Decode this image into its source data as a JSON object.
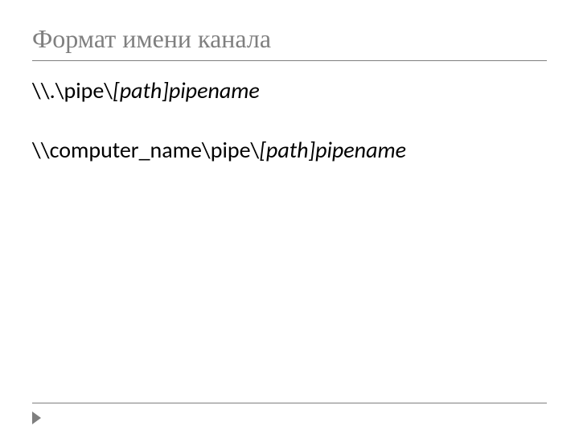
{
  "title": "Формат имени канала",
  "lines": {
    "line1_plain": "\\\\.\\pipe\\",
    "line1_italic": "[path]pipename",
    "line2_plain": "\\\\computer_name\\pipe\\",
    "line2_italic": "[path]pipename"
  }
}
